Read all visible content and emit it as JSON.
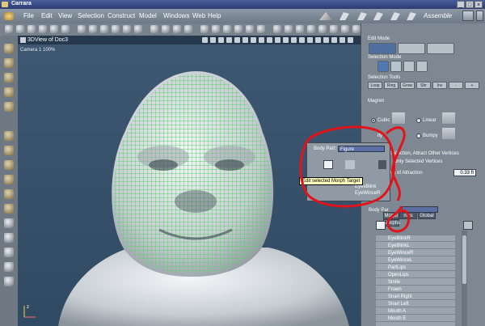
{
  "window": {
    "title": "Carrara",
    "buttons": [
      "_",
      "□",
      "×"
    ]
  },
  "menubar": {
    "items": [
      "File",
      "Edit",
      "View",
      "Selection",
      "Construct",
      "Model",
      "Windows",
      "Web",
      "Help"
    ],
    "room": "Assemble"
  },
  "viewport": {
    "title": "3DView of Doc3",
    "camera": "Camera 1  100%",
    "axis_label": "z"
  },
  "right_panel": {
    "edit_mode": "Edit Mode",
    "selection_mode": "Selection Mode",
    "selection_tools": "Selection Tools",
    "tool_buttons": [
      "Loop",
      "Ring",
      "Grow",
      "Shr",
      "Inv",
      "-",
      "+"
    ],
    "magnet": "Magnet",
    "magnet_options": [
      "Cubic",
      "Linear",
      "Bumpy"
    ],
    "magnet_partial": "ity",
    "attract_text": "Selection, Attract Other Vertices",
    "only_selected": "Only Selected Vertices",
    "radius_label": "us of Attraction",
    "radius_value": "0.33 ft"
  },
  "popup": {
    "body_part_label": "Body Part:",
    "body_part_value": "Figure",
    "list_partial": [
      "EyesBlink",
      "EyeWinceR"
    ]
  },
  "tooltip": "Edit selected Morph Target",
  "tabs": [
    "Morph",
    "Morphs",
    "mes",
    "Global"
  ],
  "morph_panel": {
    "body_part_label": "Body Par",
    "items": [
      "EyeBlinkR",
      "EyeBlinkL",
      "EyeWinceR",
      "EyeWinceL",
      "PartLips",
      "OpenLips",
      "Smile",
      "Frown",
      "Snarl Right",
      "Snarl Left",
      "Mouth A",
      "Mouth E"
    ]
  },
  "colors": {
    "wireframe": "#5dd86a",
    "annotation": "#e0141a",
    "viewport_bg": "#3a5470",
    "panel_bg": "#7d8893",
    "menubar": "#7a8692"
  }
}
